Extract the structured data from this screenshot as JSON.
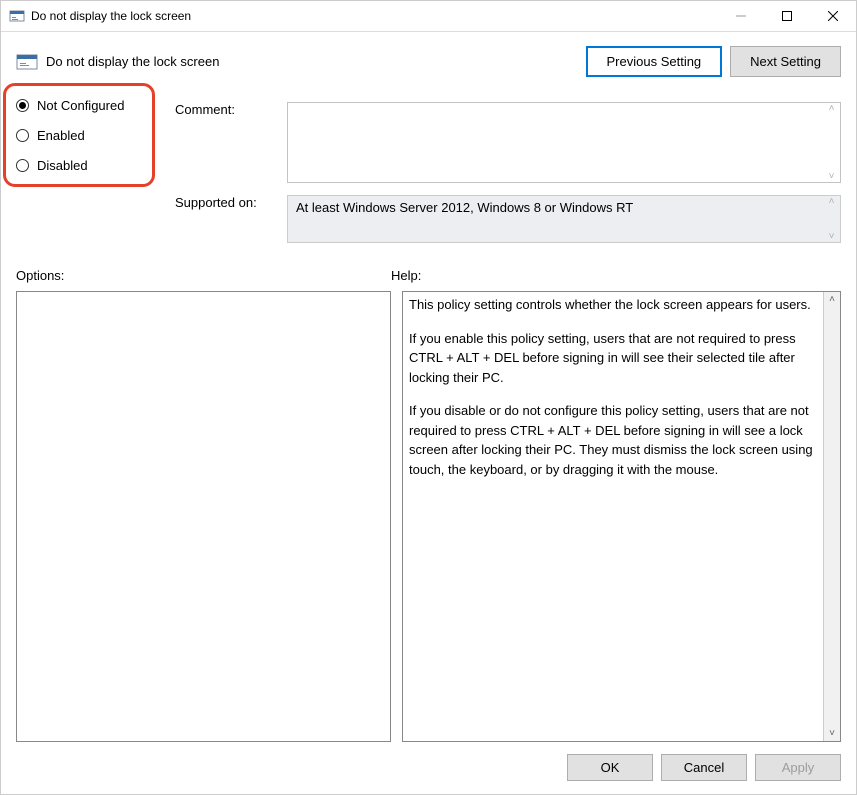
{
  "window": {
    "title": "Do not display the lock screen"
  },
  "header": {
    "title": "Do not display the lock screen",
    "prev": "Previous Setting",
    "next": "Next Setting"
  },
  "state": {
    "options": [
      {
        "label": "Not Configured",
        "checked": true
      },
      {
        "label": "Enabled",
        "checked": false
      },
      {
        "label": "Disabled",
        "checked": false
      }
    ]
  },
  "labels": {
    "comment": "Comment:",
    "supported": "Supported on:",
    "options": "Options:",
    "help": "Help:"
  },
  "commentText": "",
  "supportedText": "At least Windows Server 2012, Windows 8 or Windows RT",
  "help": {
    "p1": "This policy setting controls whether the lock screen appears for users.",
    "p2": "If you enable this policy setting, users that are not required to press CTRL + ALT + DEL before signing in will see their selected tile after locking their PC.",
    "p3": "If you disable or do not configure this policy setting, users that are not required to press CTRL + ALT + DEL before signing in will see a lock screen after locking their PC. They must dismiss the lock screen using touch, the keyboard, or by dragging it with the mouse."
  },
  "footer": {
    "ok": "OK",
    "cancel": "Cancel",
    "apply": "Apply"
  }
}
